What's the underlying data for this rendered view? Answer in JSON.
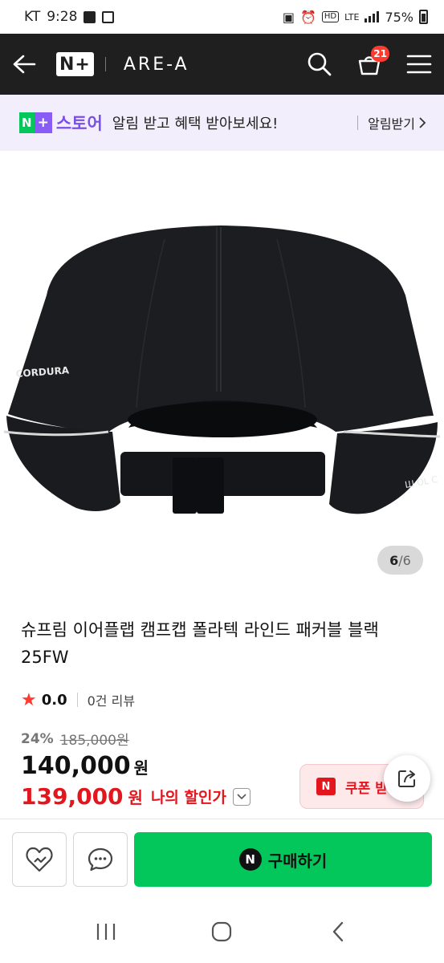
{
  "status_bar": {
    "carrier": "KT",
    "time": "9:28",
    "network": "LTE",
    "hd": "HD",
    "battery": "75%"
  },
  "header": {
    "logo_text": "N+",
    "brand": "ARE-A",
    "cart_count": "21",
    "icons": [
      "back-arrow-icon",
      "search-icon",
      "cart-icon",
      "menu-icon"
    ]
  },
  "promo": {
    "logo_n": "N",
    "logo_plus": "+",
    "store": "스토어",
    "message": "알림 받고 혜택 받아보세요!",
    "cta": "알림받기"
  },
  "gallery": {
    "current": "6",
    "separator": " / ",
    "total": "6"
  },
  "product": {
    "title": "슈프림 이어플랩 캠프캡 폴라텍 라인드 패커블 블랙 25FW",
    "rating": "0.0",
    "reviews": "0건 리뷰",
    "discount_rate": "24%",
    "original_price": "185,000원",
    "price": "140,000",
    "price_unit": "원",
    "my_price": "139,000",
    "my_price_unit": "원",
    "my_price_label": "나의 할인가"
  },
  "coupon": {
    "badge": "N",
    "label": "쿠폰 받기"
  },
  "actions": {
    "buy_badge": "N",
    "buy_label": "구매하기"
  },
  "colors": {
    "header_bg": "#1f1f1f",
    "promo_bg": "#f2eefb",
    "naver_green": "#03c75a",
    "sale_red": "#e3161e",
    "promo_purple": "#7a4fe8"
  }
}
